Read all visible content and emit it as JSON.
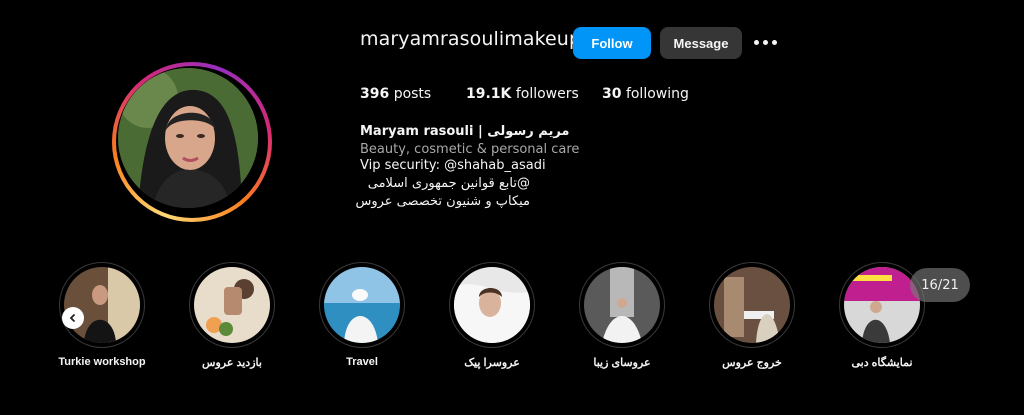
{
  "profile": {
    "username": "maryamrasoulimakeup",
    "follow_label": "Follow",
    "message_label": "Message",
    "posts_count": "396",
    "posts_label": "posts",
    "followers_count": "19.1K",
    "followers_label": "followers",
    "following_count": "30",
    "following_label": "following",
    "full_name": "Maryam rasouli | مریم رسولی",
    "category": "Beauty, cosmetic & personal care",
    "bio_line1": "Vip security: @shahab_asadi",
    "bio_line2": "@تابع قوانین جمهوری اسلامی",
    "bio_line3": "میکاپ و شنیون تخصصی عروس"
  },
  "highlights": [
    {
      "label": "Turkie workshop"
    },
    {
      "label": "بازدید عروس"
    },
    {
      "label": "Travel"
    },
    {
      "label": "عروسرا پیک"
    },
    {
      "label": "عروسای زیبا"
    },
    {
      "label": "خروج عروس"
    },
    {
      "label": "نمایشگاه دبی"
    }
  ],
  "carousel": {
    "counter": "16/21"
  },
  "colors": {
    "accent": "#0095f6",
    "secondary_button": "#363636",
    "background": "#000000"
  },
  "icons": {
    "more": "more-options-icon",
    "prev": "chevron-left-icon"
  }
}
